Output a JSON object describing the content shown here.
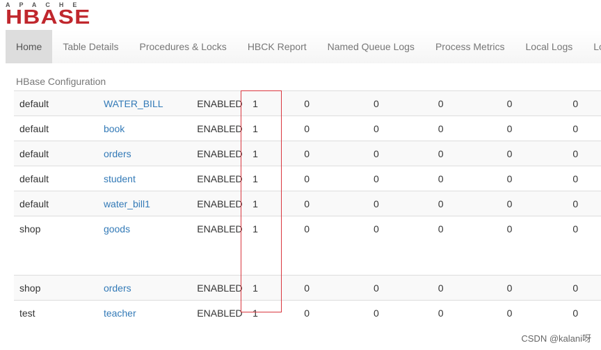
{
  "logo": {
    "top": "APACHE",
    "main": "HBASE"
  },
  "nav": {
    "items": [
      "Home",
      "Table Details",
      "Procedures & Locks",
      "HBCK Report",
      "Named Queue Logs",
      "Process Metrics",
      "Local Logs",
      "Log"
    ],
    "second_row": "HBase Configuration",
    "active": "Home"
  },
  "table": {
    "rows": [
      [
        "default",
        "WATER_BILL",
        "ENABLED",
        "1",
        "0",
        "0",
        "0",
        "0",
        "0"
      ],
      [
        "default",
        "book",
        "ENABLED",
        "1",
        "0",
        "0",
        "0",
        "0",
        "0"
      ],
      [
        "default",
        "orders",
        "ENABLED",
        "1",
        "0",
        "0",
        "0",
        "0",
        "0"
      ],
      [
        "default",
        "student",
        "ENABLED",
        "1",
        "0",
        "0",
        "0",
        "0",
        "0"
      ],
      [
        "default",
        "water_bill1",
        "ENABLED",
        "1",
        "0",
        "0",
        "0",
        "0",
        "0"
      ],
      [
        "shop",
        "goods",
        "ENABLED",
        "1",
        "0",
        "0",
        "0",
        "0",
        "0"
      ],
      [
        "shop",
        "orders",
        "ENABLED",
        "1",
        "0",
        "0",
        "0",
        "0",
        "0"
      ],
      [
        "test",
        "teacher",
        "ENABLED",
        "1",
        "0",
        "0",
        "0",
        "0",
        "0"
      ]
    ]
  },
  "highlight_color": "#d9363e",
  "watermark": "CSDN @kalani呀"
}
